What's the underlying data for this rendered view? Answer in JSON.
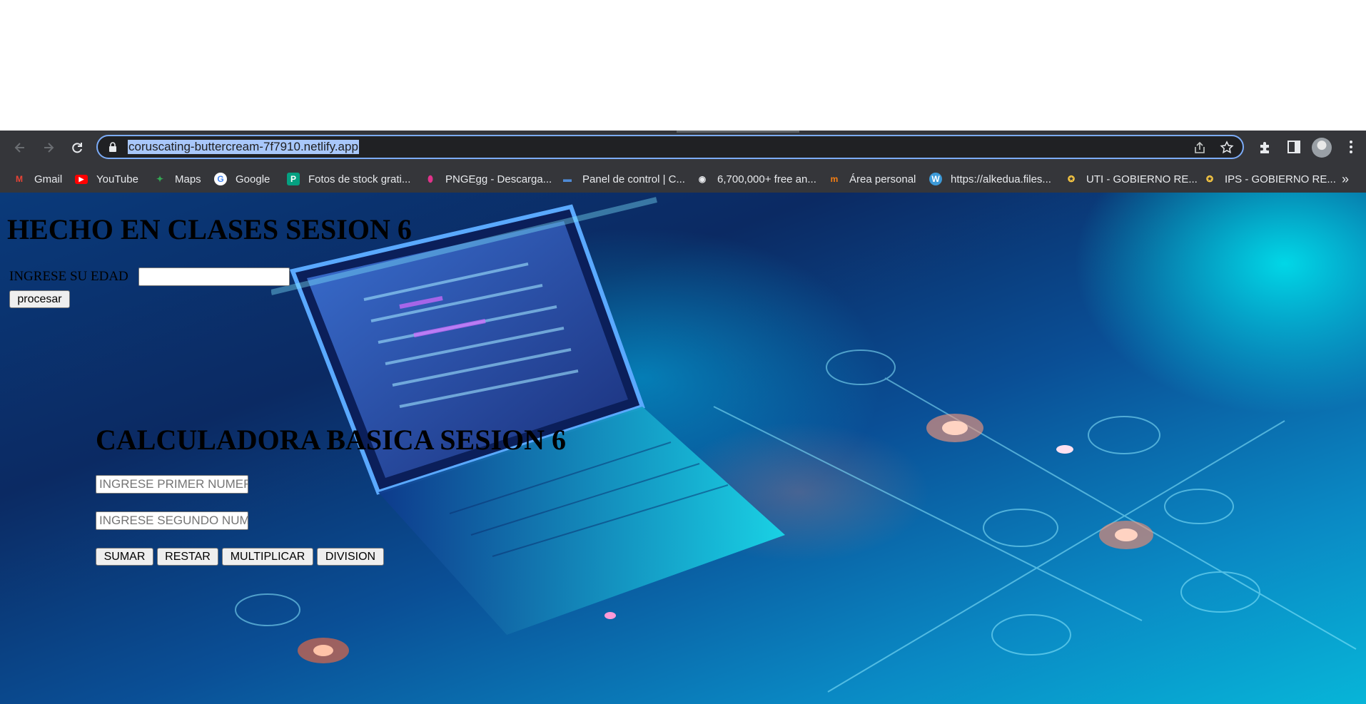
{
  "browser": {
    "url": "coruscating-buttercream-7f7910.netlify.app",
    "bookmarks": [
      {
        "label": "Gmail",
        "icon": "gmail-icon"
      },
      {
        "label": "YouTube",
        "icon": "youtube-icon"
      },
      {
        "label": "Maps",
        "icon": "maps-icon"
      },
      {
        "label": "Google",
        "icon": "google-icon"
      },
      {
        "label": "Fotos de stock grati...",
        "icon": "pexels-icon"
      },
      {
        "label": "PNGEgg - Descarga...",
        "icon": "pngegg-icon"
      },
      {
        "label": "Panel de control | C...",
        "icon": "panel-icon"
      },
      {
        "label": "6,700,000+ free an...",
        "icon": "free-icon"
      },
      {
        "label": "Área personal",
        "icon": "moodle-icon"
      },
      {
        "label": "https://alkedua.files...",
        "icon": "wordpress-icon"
      },
      {
        "label": "UTI - GOBIERNO RE...",
        "icon": "gov-icon"
      },
      {
        "label": "IPS - GOBIERNO RE...",
        "icon": "gov-icon"
      }
    ],
    "more": "»"
  },
  "page": {
    "title1": "HECHO EN CLASES SESION 6",
    "age_label": "INGRESE SU EDAD",
    "age_value": "",
    "process_button": "procesar",
    "title2": "CALCULADORA BASICA SESION 6",
    "first_placeholder": "INGRESE PRIMER NUMERO",
    "second_placeholder": "INGRESE SEGUNDO NUMERO",
    "buttons": {
      "add": "SUMAR",
      "subtract": "RESTAR",
      "multiply": "MULTIPLICAR",
      "divide": "DIVISION"
    }
  }
}
